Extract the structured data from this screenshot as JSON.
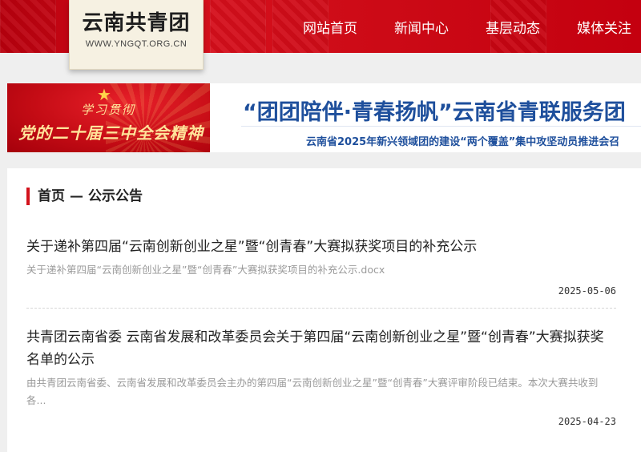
{
  "site": {
    "name": "云南共青团",
    "url": "WWW.YNGQT.ORG.CN"
  },
  "nav": {
    "items": [
      {
        "label": "网站首页"
      },
      {
        "label": "新闻中心"
      },
      {
        "label": "基层动态"
      },
      {
        "label": "媒体关注"
      }
    ]
  },
  "banner": {
    "promo_line1": "学习贯彻",
    "promo_line2": "党的二十届三中全会精神",
    "headline": "“团团陪伴·青春扬帆”云南省青联服务团",
    "subheadline": "云南省2025年新兴领域团的建设“两个覆盖”集中攻坚动员推进会召"
  },
  "breadcrumb": {
    "home": "首页",
    "separator": "—",
    "section": "公示公告"
  },
  "articles": [
    {
      "title": "关于递补第四届“云南创新创业之星”暨“创青春”大赛拟获奖项目的补充公示",
      "summary": "关于递补第四届“云南创新创业之星”暨“创青春”大赛拟获奖项目的补充公示.docx",
      "date": "2025-05-06"
    },
    {
      "title": "共青团云南省委 云南省发展和改革委员会关于第四届“云南创新创业之星”暨“创青春”大赛拟获奖名单的公示",
      "summary": "由共青团云南省委、云南省发展和改革委员会主办的第四届“云南创新创业之星”暨“创青春”大赛评审阶段已结束。本次大赛共收到各...",
      "date": "2025-04-23"
    }
  ],
  "colors": {
    "header_red": "#cc0a16",
    "headline_blue": "#1e4f9c",
    "accent_red": "#d3121c"
  }
}
